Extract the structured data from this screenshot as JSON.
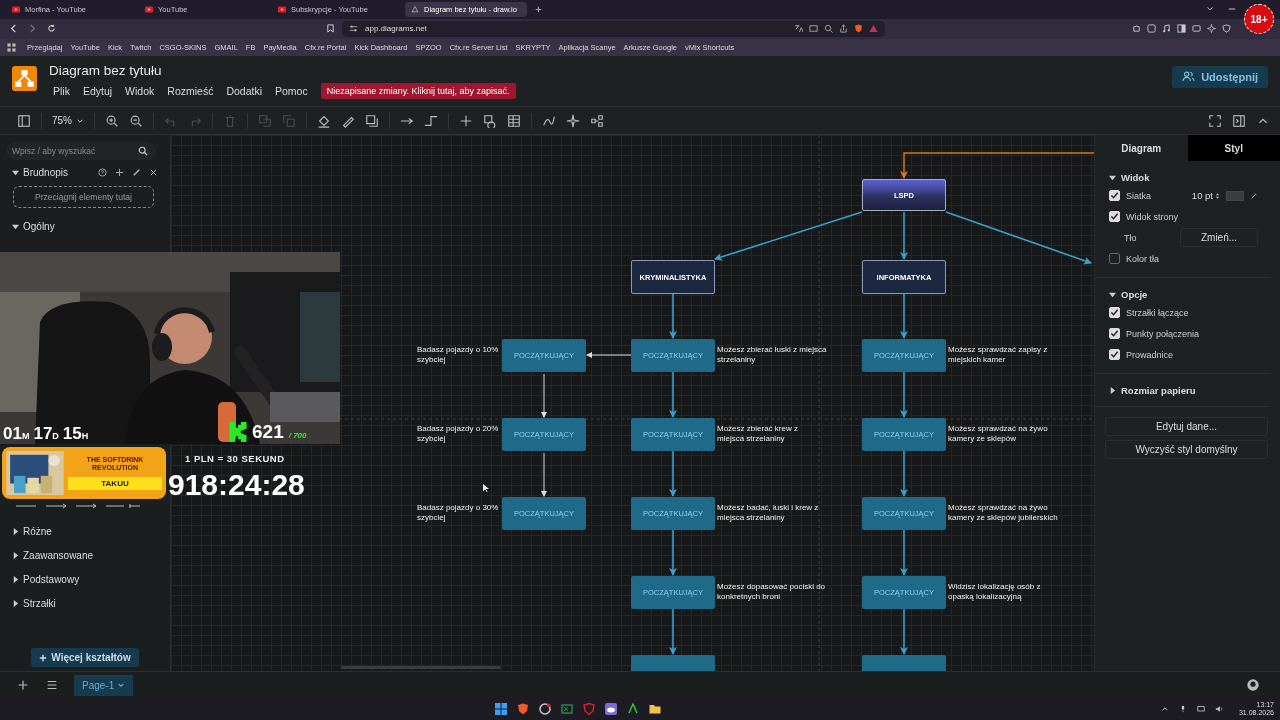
{
  "browser": {
    "tabs": [
      {
        "label": "Morfina - YouTube",
        "selected": false
      },
      {
        "label": "YouTube",
        "selected": false
      },
      {
        "label": "Subskrypcje - YouTube",
        "selected": false
      },
      {
        "label": "Diagram bez tytułu - draw.io",
        "selected": true
      }
    ],
    "address": "app.diagrams.net",
    "bookmarks": [
      "Przeglądaj",
      "YouTube",
      "Kick",
      "Twitch",
      "CSGO-SKINS",
      "GMAIL",
      "FB",
      "PayMedia",
      "Cfx.re Portal",
      "Kick Dashboard",
      "SPZOO",
      "Cfx.re Server List",
      "SKRYPTY",
      "Aplikacja Scanye",
      "Arkusze Google",
      "vMix Shortcuts"
    ]
  },
  "app": {
    "title": "Diagram bez tytułu",
    "menu": [
      "Plik",
      "Edytuj",
      "Widok",
      "Rozmieść",
      "Dodatki",
      "Pomoc"
    ],
    "notice": "Niezapisane zmiany. Kliknij tutaj, aby zapisać.",
    "share_button": "Udostępnij"
  },
  "toolbar": {
    "zoom": "75%"
  },
  "sidebar": {
    "search_placeholder": "Wpisz / aby wyszukać",
    "scratchpad": {
      "title": "Brudnopis",
      "expanded": true,
      "drop_hint": "Przeciągnij elementy tutaj"
    },
    "sections": [
      {
        "label": "Ogólny",
        "expanded": true
      },
      {
        "label": "Różne",
        "expanded": false
      },
      {
        "label": "Zaawansowane",
        "expanded": false
      },
      {
        "label": "Podstawowy",
        "expanded": false
      },
      {
        "label": "Strzałki",
        "expanded": false
      }
    ],
    "more_shapes": "Więcej kształtów"
  },
  "diagram": {
    "root": "LSPD",
    "branches": [
      {
        "label": "KRYMINALISTYKA",
        "continues": true,
        "levels": [
          {
            "label": "POCZĄTKUJĄCY",
            "note": "Możesz zbierać łuski z miejsca strzelaniny"
          },
          {
            "label": "POCZĄTKUJĄCY",
            "note": "Możesz zbierać krew z miejsca strzelaniny"
          },
          {
            "label": "POCZĄTKUJĄCY",
            "note": "Możesz badać, łuski i krew z miejsca strzelaniny"
          },
          {
            "label": "POCZĄTKUJĄCY",
            "note": "Możesz dopasować pociski do konkretnych broni"
          }
        ],
        "side_branch": {
          "levels": [
            {
              "label": "POCZĄTKUJĄCY",
              "note": "Badasz pojazdy o 10% szybciej"
            },
            {
              "label": "POCZĄTKUJĄCY",
              "note": "Badasz pojazdy o 20% szybciej"
            },
            {
              "label": "POCZĄTKUJĄCY",
              "note": "Badasz pojazdy o 30% szybciej"
            }
          ]
        }
      },
      {
        "label": "INFORMATYKA",
        "continues": true,
        "levels": [
          {
            "label": "POCZĄTKUJĄCY",
            "note": "Możesz sprawdzać zapisy z miejskich kamer"
          },
          {
            "label": "POCZĄTKUJĄCY",
            "note": "Możesz sprawdzać na żywo kamery ze sklepów"
          },
          {
            "label": "POCZĄTKUJĄCY",
            "note": "Możesz sprawdzać na żywo kamery ze sklepów jubilerskich"
          },
          {
            "label": "POCZĄTKUJĄCY",
            "note": "Widzisz lokalizację osób z opaską lokalizacyjną"
          }
        ]
      }
    ]
  },
  "format_panel": {
    "tabs": [
      {
        "label": "Diagram",
        "selected": true
      },
      {
        "label": "Styl",
        "selected": false
      }
    ],
    "sections": [
      {
        "title": "Widok",
        "expanded": true,
        "rows": [
          {
            "kind": "checkbox",
            "label": "Siatka",
            "checked": true,
            "value": "10 pt"
          },
          {
            "kind": "checkbox",
            "label": "Widok strony",
            "checked": true
          },
          {
            "kind": "button",
            "label": "Tło",
            "button": "Zmień..."
          },
          {
            "kind": "checkbox",
            "label": "Kolor tła",
            "checked": false
          }
        ]
      },
      {
        "title": "Opcje",
        "expanded": true,
        "rows": [
          {
            "kind": "checkbox",
            "label": "Strzałki łączące",
            "checked": true
          },
          {
            "kind": "checkbox",
            "label": "Punkty połączenia",
            "checked": true
          },
          {
            "kind": "checkbox",
            "label": "Prowadnice",
            "checked": true
          }
        ]
      },
      {
        "title": "Rozmiar papieru",
        "expanded": false
      }
    ],
    "buttons": [
      "Edytuj dane...",
      "Wyczyść styl domyślny"
    ]
  },
  "pages": [
    {
      "label": "Page-1",
      "selected": true
    }
  ],
  "stream_overlay": {
    "countdown": [
      {
        "value": "01",
        "unit": "M"
      },
      {
        "value": "17",
        "unit": "D"
      },
      {
        "value": "15",
        "unit": "H"
      }
    ],
    "subs": "621",
    "subs_goal": "/ 700",
    "promo_title": "THE SOFTDRINK REVOLUTION",
    "promo_button": "TAKUU",
    "rate": "1 PLN = 30 SEKUND",
    "timer": "918:24:28",
    "age_badge": "18+"
  },
  "taskbar": {
    "time": "13:17",
    "date": "31.08.2026"
  }
}
